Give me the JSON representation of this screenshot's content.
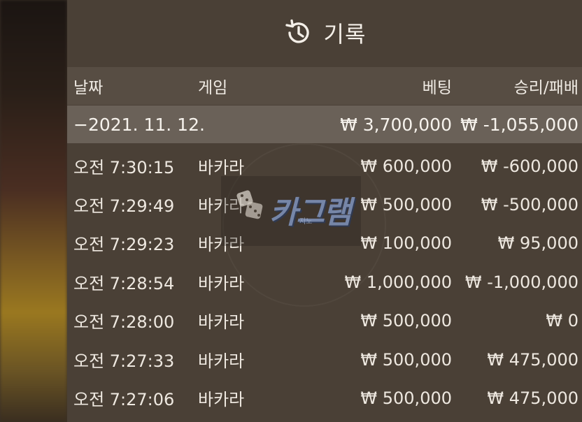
{
  "title": "기록",
  "icons": {
    "title": "history-icon"
  },
  "columns": {
    "date": "날짜",
    "game": "게임",
    "bet": "베팅",
    "result": "승리/패배"
  },
  "summary": {
    "date": "−2021. 11. 12.",
    "bet": "₩ 3,700,000",
    "result": "₩ -1,055,000"
  },
  "rows": [
    {
      "time": "오전 7:30:15",
      "game": "바카라",
      "bet": "₩ 600,000",
      "result": "₩ -600,000"
    },
    {
      "time": "오전 7:29:49",
      "game": "바카라",
      "bet": "₩ 500,000",
      "result": "₩ -500,000"
    },
    {
      "time": "오전 7:29:23",
      "game": "바카라",
      "bet": "₩ 100,000",
      "result": "₩ 95,000"
    },
    {
      "time": "오전 7:28:54",
      "game": "바카라",
      "bet": "₩ 1,000,000",
      "result": "₩ -1,000,000"
    },
    {
      "time": "오전 7:28:00",
      "game": "바카라",
      "bet": "₩ 500,000",
      "result": "₩ 0"
    },
    {
      "time": "오전 7:27:33",
      "game": "바카라",
      "bet": "₩ 500,000",
      "result": "₩ 475,000"
    },
    {
      "time": "오전 7:27:06",
      "game": "바카라",
      "bet": "₩ 500,000",
      "result": "₩ 475,000"
    }
  ],
  "watermark": {
    "text": "카그램",
    "sub": "지노"
  },
  "colors": {
    "panel": "#4a4036",
    "header": "#574d43",
    "summary": "#6a6158",
    "text": "#f2ede6"
  }
}
